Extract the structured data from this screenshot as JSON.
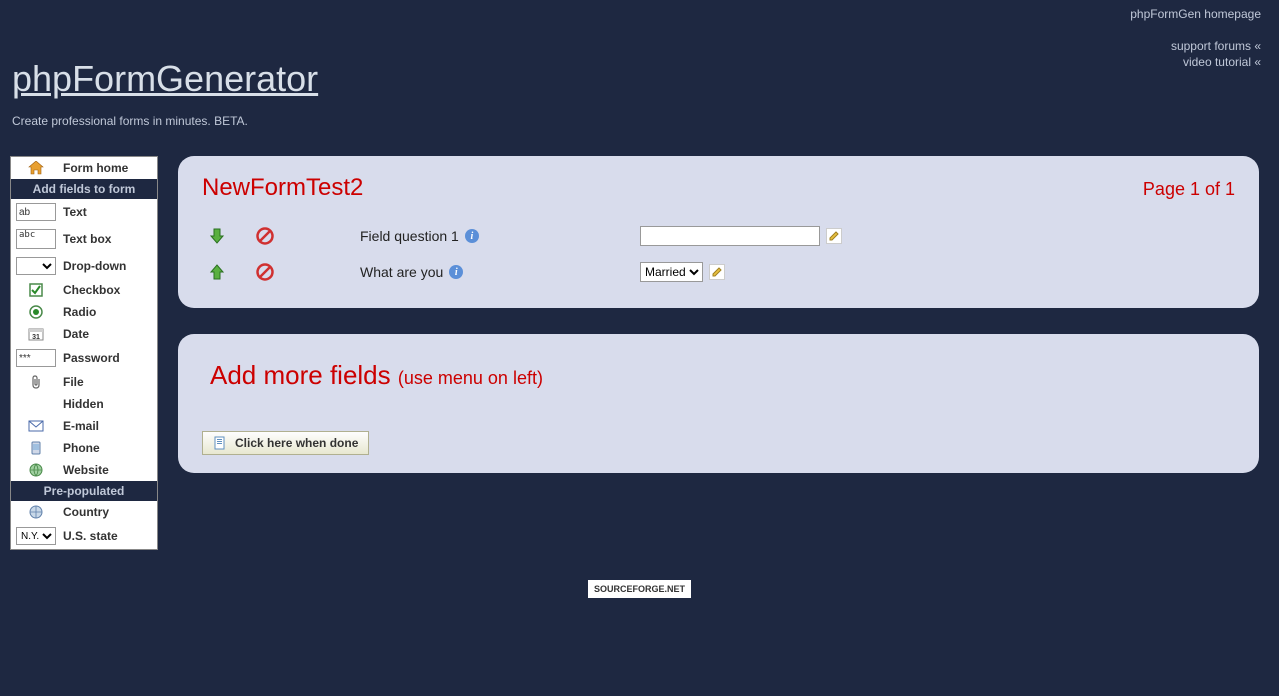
{
  "topLinks": {
    "homepage": "phpFormGen homepage",
    "forums": "support forums «",
    "tutorial": "video tutorial «"
  },
  "header": {
    "title": "phpFormGenerator",
    "tagline": "Create professional forms in minutes. BETA."
  },
  "sidebar": {
    "formHome": "Form home",
    "addFieldsHeader": "Add fields to form",
    "items": {
      "text": {
        "label": "Text",
        "sample": "ab"
      },
      "textbox": {
        "label": "Text box",
        "sample": "abc"
      },
      "dropdown": {
        "label": "Drop-down"
      },
      "checkbox": {
        "label": "Checkbox"
      },
      "radio": {
        "label": "Radio"
      },
      "date": {
        "label": "Date"
      },
      "password": {
        "label": "Password",
        "sample": "***"
      },
      "file": {
        "label": "File"
      },
      "hidden": {
        "label": "Hidden"
      },
      "email": {
        "label": "E-mail"
      },
      "phone": {
        "label": "Phone"
      },
      "website": {
        "label": "Website"
      }
    },
    "prePopHeader": "Pre-populated",
    "prePop": {
      "country": {
        "label": "Country"
      },
      "usstate": {
        "label": "U.S. state",
        "sample": "N.Y."
      }
    }
  },
  "form": {
    "title": "NewFormTest2",
    "pageIndicator": "Page 1 of 1",
    "fields": [
      {
        "label": "Field question 1",
        "type": "text",
        "value": ""
      },
      {
        "label": "What are you",
        "type": "select",
        "selected": "Married"
      }
    ]
  },
  "addMore": {
    "title": "Add more fields ",
    "sub": "(use menu on left)",
    "doneButton": "Click here when done"
  },
  "footer": {
    "badge": "SOURCEFORGE.NET"
  }
}
